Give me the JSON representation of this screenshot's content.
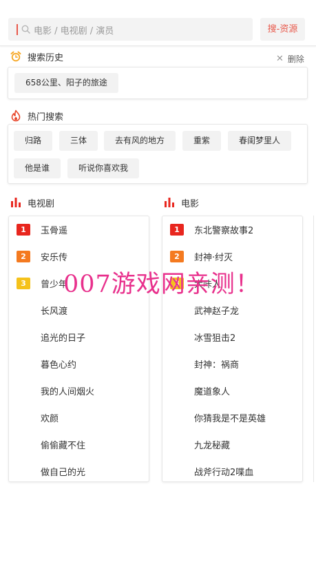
{
  "search": {
    "placeholder": "电影 / 电视剧 / 演员",
    "button_label": "搜-资源",
    "accent_color": "#e8584a"
  },
  "history": {
    "title": "搜索历史",
    "delete_label": "删除",
    "items": [
      "658公里、阳子的旅途"
    ]
  },
  "hot": {
    "title": "热门搜索",
    "tags": [
      "归路",
      "三体",
      "去有风的地方",
      "重紫",
      "春闺梦里人",
      "他是谁",
      "听说你喜欢我"
    ]
  },
  "rankings": {
    "tv": {
      "title": "电视剧",
      "items": [
        "玉骨遥",
        "安乐传",
        "曾少年",
        "长风渡",
        "追光的日子",
        "暮色心约",
        "我的人间烟火",
        "欢颜",
        "偷偷藏不住",
        "做自己的光"
      ]
    },
    "movie": {
      "title": "电影",
      "items": [
        "东北警察故事2",
        "封神·纣灭",
        "大咔人",
        "武神赵子龙",
        "冰雪狙击2",
        "封神：祸商",
        "魔道象人",
        "你猜我是不是英雄",
        "九龙秘藏",
        "战斧行动2喋血"
      ]
    },
    "badges": [
      "1",
      "2",
      "3"
    ],
    "badge_colors": [
      "#e8261e",
      "#f47a20",
      "#f5c21b"
    ]
  },
  "watermark": "007游戏网亲测！"
}
